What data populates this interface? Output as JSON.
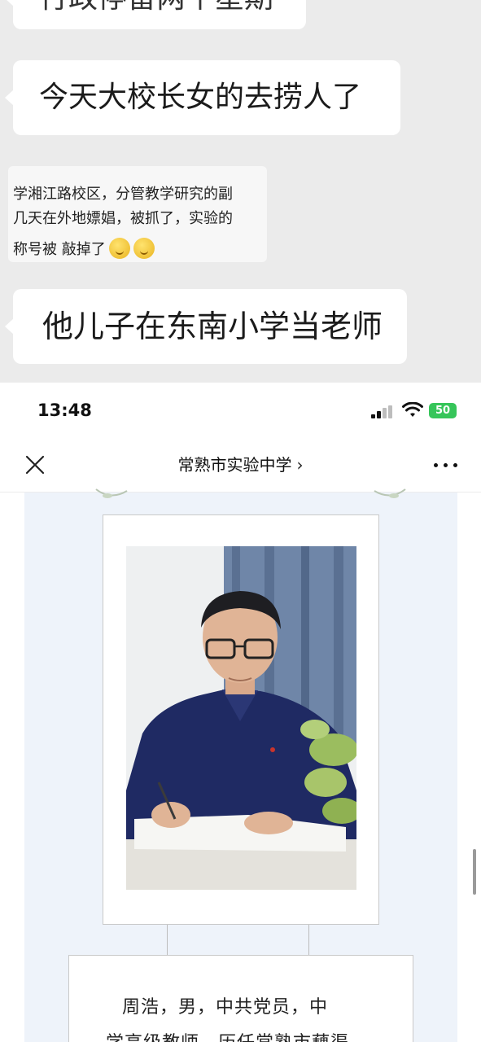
{
  "chat": {
    "bubble_cut_top": "行政停留两个星期",
    "bubble_principal": "今天大校长女的去捞人了",
    "forwarded_image": {
      "line1": "学湘江路校区，分管教学研究的副",
      "line2": "几天在外地嫖娼，被抓了，实验的",
      "line3": "称号被 敲掉了",
      "emoji_count": 2
    },
    "bubble_son": "他儿子在东南小学当老师"
  },
  "status_bar": {
    "time": "13:48",
    "battery": "50"
  },
  "nav": {
    "title": "常熟市实验中学",
    "chevron": "›"
  },
  "article": {
    "bio_line1": "周浩，男，中共党员，中",
    "bio_line2": "学高级教师，历任常熟市藕渠"
  },
  "icons": [
    "signal-icon",
    "wifi-icon",
    "battery-icon",
    "close-icon",
    "more-icon",
    "smiley-emoji-icon"
  ],
  "colors": {
    "chat_background": "#ebebeb",
    "bubble": "#ffffff",
    "article_background": "#eef3fa",
    "battery_green": "#36c55a",
    "shirt_navy": "#1f2a63"
  }
}
